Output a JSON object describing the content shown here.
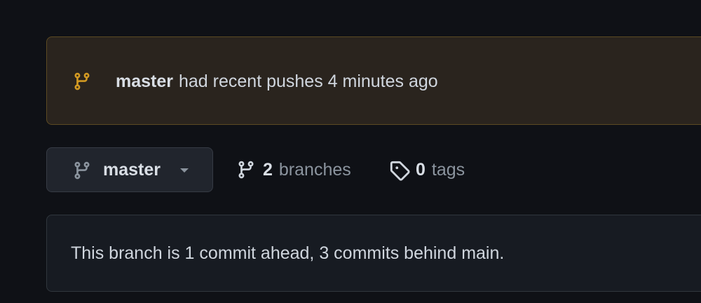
{
  "push_banner": {
    "branch": "master",
    "message": "had recent pushes 4 minutes ago",
    "icon": "git-branch-icon",
    "accent_color": "#d29922"
  },
  "branch_selector": {
    "label": "master",
    "icon": "git-branch-icon",
    "caret": "chevron-down-icon"
  },
  "branches": {
    "count": "2",
    "unit": "branches",
    "icon": "git-branch-icon"
  },
  "tags": {
    "count": "0",
    "unit": "tags",
    "icon": "tag-icon"
  },
  "status": {
    "message": "This branch is 1 commit ahead, 3 commits behind main."
  }
}
